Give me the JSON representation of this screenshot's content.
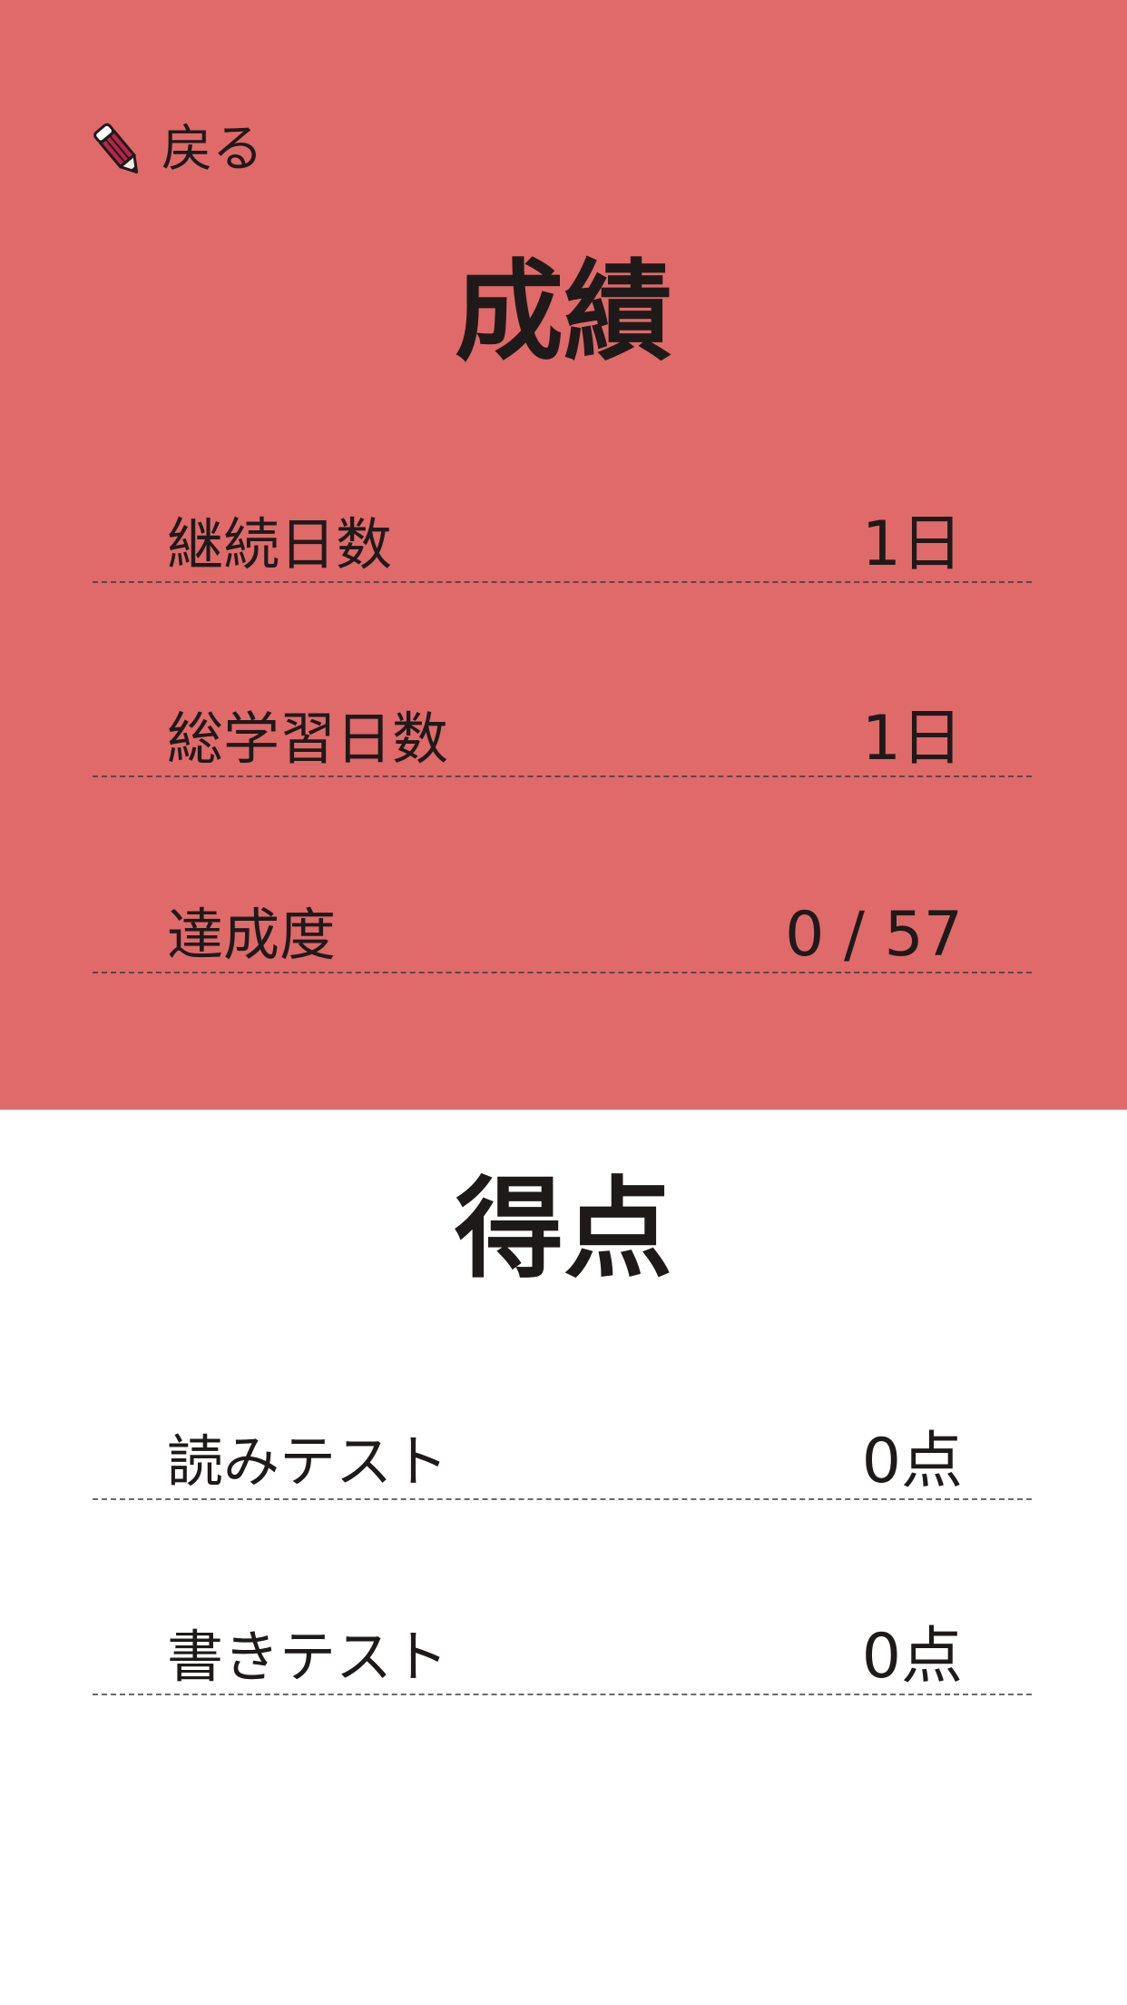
{
  "header": {
    "back_label": "戻る"
  },
  "record": {
    "title": "成績",
    "rows": [
      {
        "label": "継続日数",
        "value": "1日"
      },
      {
        "label": "総学習日数",
        "value": "1日"
      },
      {
        "label": "達成度",
        "value": "0 / 57"
      }
    ]
  },
  "score": {
    "title": "得点",
    "rows": [
      {
        "label": "読みテスト",
        "value": "0点"
      },
      {
        "label": "書きテスト",
        "value": "0点"
      }
    ]
  },
  "colors": {
    "accent": "#e0696a",
    "text": "#1f1a1a",
    "background": "#ffffff"
  },
  "icons": {
    "back": "pencil-icon"
  }
}
